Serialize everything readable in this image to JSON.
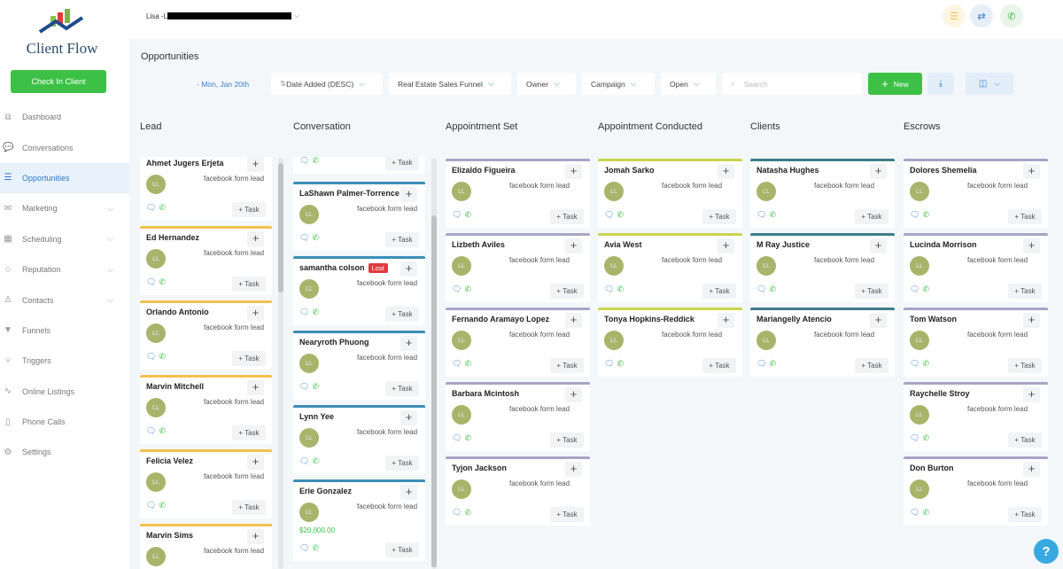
{
  "app": {
    "logo_text": "Client Flow",
    "check_in": "Check In Client",
    "user": "Lisa -L"
  },
  "sidebar": {
    "items": [
      {
        "label": "Dashboard",
        "icon": "dashboard-icon",
        "glyph": "⧉",
        "chev": false
      },
      {
        "label": "Conversations",
        "icon": "chat-icon",
        "glyph": "💬",
        "chev": false
      },
      {
        "label": "Opportunities",
        "icon": "opportunities-icon",
        "glyph": "☰",
        "chev": false,
        "active": true
      },
      {
        "label": "Marketing",
        "icon": "mail-icon",
        "glyph": "✉",
        "chev": true
      },
      {
        "label": "Scheduling",
        "icon": "calendar-icon",
        "glyph": "▦",
        "chev": true
      },
      {
        "label": "Reputation",
        "icon": "star-icon",
        "glyph": "☆",
        "chev": true
      },
      {
        "label": "Contacts",
        "icon": "person-icon",
        "glyph": "♙",
        "chev": true
      },
      {
        "label": "Funnels",
        "icon": "funnel-icon",
        "glyph": "▼",
        "chev": false
      },
      {
        "label": "Triggers",
        "icon": "trigger-icon",
        "glyph": "⑂",
        "chev": false
      },
      {
        "label": "Online Listings",
        "icon": "pulse-icon",
        "glyph": "∿",
        "chev": false
      },
      {
        "label": "Phone Calls",
        "icon": "phone-device-icon",
        "glyph": "▯",
        "chev": false
      },
      {
        "label": "Settings",
        "icon": "gear-icon",
        "glyph": "⚙",
        "chev": false
      }
    ]
  },
  "page": {
    "title": "Opportunities",
    "date": "- Mon, Jan 20th"
  },
  "filters": {
    "sort": "Date Added (DESC)",
    "pipeline": "Real Estate Sales Funnel",
    "owner": "Owner",
    "campaign": "Campaign",
    "status": "Open",
    "search_placeholder": "Search",
    "new": "New"
  },
  "colors": {
    "lead": "#f2c14e",
    "conversation": "#3b8fb8",
    "appointment_set": "#a9a4c6",
    "appointment_conducted": "#c9d44b",
    "clients": "#3e7d86",
    "escrows": "#a9a4c6"
  },
  "card": {
    "source": "facebook form lead",
    "avatar": "LL",
    "task": "+ Task",
    "lost": "Lost"
  },
  "columns": [
    {
      "title": "Lead",
      "key": "lead",
      "cards": [
        {
          "name": "Ahmet Jugers Erjeta"
        },
        {
          "name": "Ed Hernandez"
        },
        {
          "name": "Orlando Antonio"
        },
        {
          "name": "Marvin Mitchell"
        },
        {
          "name": "Felicia Velez"
        },
        {
          "name": "Marvin Sims"
        }
      ]
    },
    {
      "title": "Conversation",
      "key": "conversation",
      "cards": [
        {
          "name": ""
        },
        {
          "name": "LaShawn Palmer-Torrence"
        },
        {
          "name": "samantha colson",
          "lost": true
        },
        {
          "name": "Nearyroth Phuong"
        },
        {
          "name": "Lynn Yee"
        },
        {
          "name": "Erie Gonzalez",
          "amount": "$20,000.00"
        }
      ]
    },
    {
      "title": "Appointment Set",
      "key": "appointment_set",
      "cards": [
        {
          "name": "Elizaldo Figueira"
        },
        {
          "name": "Lizbeth Aviles"
        },
        {
          "name": "Fernando Aramayo Lopez"
        },
        {
          "name": "Barbara Mcintosh"
        },
        {
          "name": "Tyjon Jackson"
        }
      ]
    },
    {
      "title": "Appointment Conducted",
      "key": "appointment_conducted",
      "cards": [
        {
          "name": "Jomah Sarko"
        },
        {
          "name": "Avia West"
        },
        {
          "name": "Tonya Hopkins-Reddick"
        }
      ]
    },
    {
      "title": "Clients",
      "key": "clients",
      "cards": [
        {
          "name": "Natasha Hughes"
        },
        {
          "name": "M Ray Justice"
        },
        {
          "name": "Mariangelly Atencio"
        }
      ]
    },
    {
      "title": "Escrows",
      "key": "escrows",
      "cards": [
        {
          "name": "Dolores Shemelia"
        },
        {
          "name": "Lucinda Morrison"
        },
        {
          "name": "Tom Watson"
        },
        {
          "name": "Raychelle Stroy"
        },
        {
          "name": "Don Burton"
        }
      ]
    }
  ]
}
